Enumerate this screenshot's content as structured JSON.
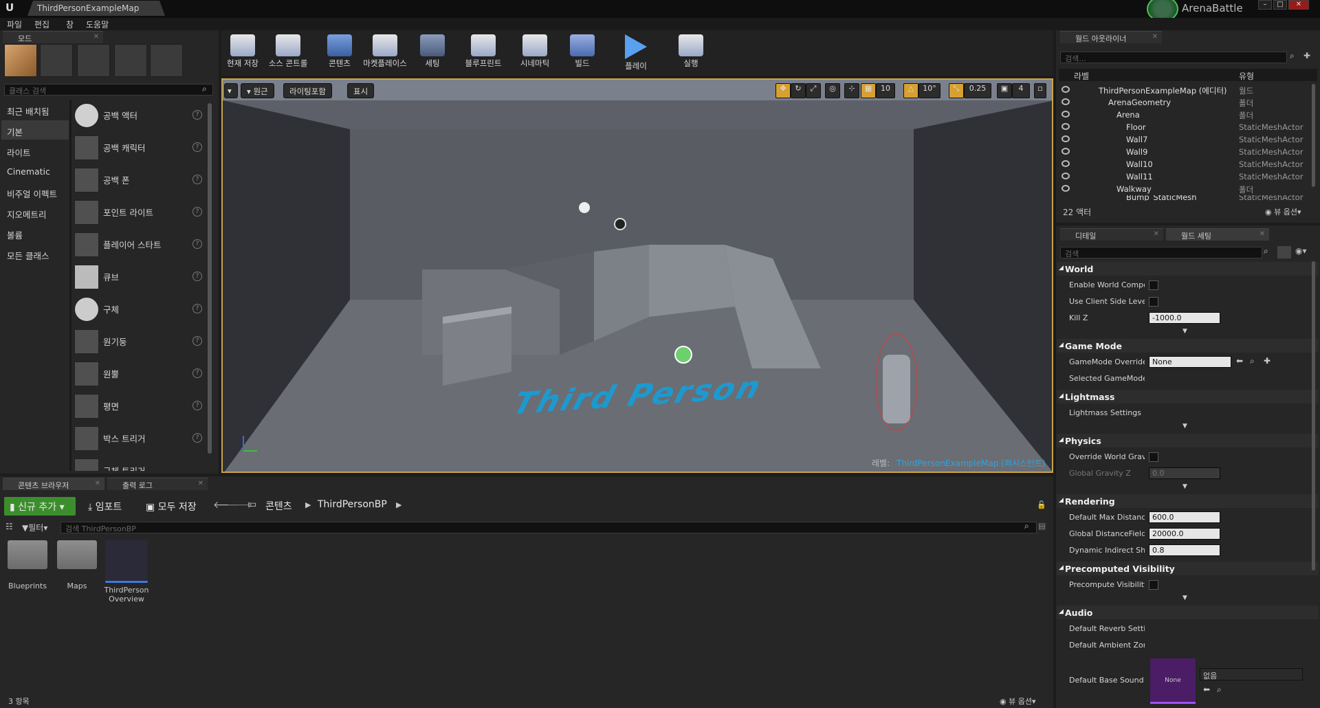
{
  "titlebar": {
    "doc_tab": "ThirdPersonExampleMap",
    "project": "ArenaBattle"
  },
  "menu": {
    "items": [
      "파일",
      "편집",
      "창",
      "도움말"
    ]
  },
  "modes": {
    "tab": "모드",
    "search_placeholder": "클래스 검색",
    "categories": [
      "최근 배치됨",
      "기본",
      "라이트",
      "Cinematic",
      "비주얼 이펙트",
      "지오메트리",
      "볼륨",
      "모든 클래스"
    ],
    "items": [
      "공백 액터",
      "공백 캐릭터",
      "공백 폰",
      "포인트 라이트",
      "플레이어 스타트",
      "큐브",
      "구체",
      "원기둥",
      "원뿔",
      "평면",
      "박스 트리거",
      "구체 트리거"
    ]
  },
  "toolbar": {
    "buttons": [
      "현재 저장",
      "소스 콘트롤",
      "콘텐츠",
      "마켓플레이스",
      "세팅",
      "블루프린트",
      "시네마틱",
      "빌드",
      "플레이",
      "실행"
    ]
  },
  "viewport": {
    "perspective": "원근",
    "lit": "라이팅포함",
    "show": "표시",
    "grid_snap": "10",
    "rot_snap": "10°",
    "scale_snap": "0.25",
    "cam_speed": "4",
    "level_label": "레벨:",
    "level_name": "ThirdPersonExampleMap (퍼시스턴트)",
    "floor_text": "Third Person"
  },
  "outliner": {
    "tab": "월드 아웃라이너",
    "search_placeholder": "검색...",
    "col_label": "라벨",
    "col_type": "유형",
    "rows": [
      {
        "label": "ThirdPersonExampleMap (에디터)",
        "type": "월드"
      },
      {
        "label": "ArenaGeometry",
        "type": "폴더"
      },
      {
        "label": "Arena",
        "type": "폴더"
      },
      {
        "label": "Floor",
        "type": "StaticMeshActor"
      },
      {
        "label": "Wall7",
        "type": "StaticMeshActor"
      },
      {
        "label": "Wall9",
        "type": "StaticMeshActor"
      },
      {
        "label": "Wall10",
        "type": "StaticMeshActor"
      },
      {
        "label": "Wall11",
        "type": "StaticMeshActor"
      },
      {
        "label": "Walkway",
        "type": "폴더"
      },
      {
        "label": "Bump_StaticMesh",
        "type": "StaticMeshActor"
      }
    ],
    "count": "22 액터",
    "view_options": "뷰 옵션"
  },
  "details": {
    "tab_details": "디테일",
    "tab_world": "월드 세팅",
    "search_placeholder": "검색",
    "world": {
      "title": "World",
      "enable_comp": "Enable World Composi",
      "client_level": "Use Client Side Level S",
      "kill_z": "Kill Z",
      "kill_z_val": "-1000.0"
    },
    "game_mode": {
      "title": "Game Mode",
      "override": "GameMode Override",
      "override_val": "None",
      "selected": "Selected GameMode"
    },
    "lightmass": {
      "title": "Lightmass",
      "settings": "Lightmass Settings"
    },
    "physics": {
      "title": "Physics",
      "override_gravity": "Override World Gravity",
      "gravity_z": "Global Gravity Z",
      "gravity_z_val": "0.0"
    },
    "rendering": {
      "title": "Rendering",
      "max_dist": "Default Max Distance",
      "max_dist_val": "600.0",
      "global_df": "Global DistanceField V",
      "global_df_val": "20000.0",
      "dyn_shadow": "Dynamic Indirect Shad",
      "dyn_shadow_val": "0.8"
    },
    "precomp": {
      "title": "Precomputed Visibility",
      "precompute": "Precompute Visibility"
    },
    "audio": {
      "title": "Audio",
      "reverb": "Default Reverb Setting",
      "ambient": "Default Ambient Zone",
      "base_sound": "Default Base Sound M",
      "none_label": "None",
      "none_select": "없음"
    }
  },
  "content": {
    "tab_browser": "콘텐츠 브라우저",
    "tab_log": "출력 로그",
    "add_new": "신규 추가",
    "import": "임포트",
    "save_all": "모두 저장",
    "crumb_root": "콘텐츠",
    "crumb_folder": "ThirdPersonBP",
    "filter": "필터",
    "search_placeholder": "검색 ThirdPersonBP",
    "assets": [
      "Blueprints",
      "Maps",
      "ThirdPerson Overview"
    ],
    "count": "3 항목",
    "view_options": "뷰 옵션"
  }
}
